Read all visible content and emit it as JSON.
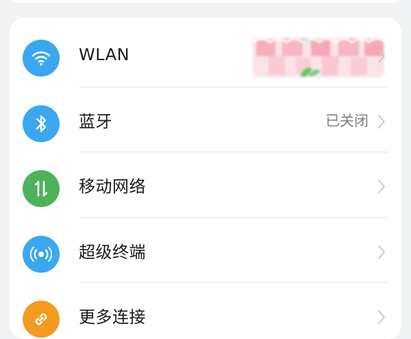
{
  "colors": {
    "blue_icon": "#3aa7f0",
    "green_icon": "#4cb35a",
    "orange_icon": "#f39a1f",
    "divider": "#e6e6e6",
    "value_text": "#808080"
  },
  "settings": {
    "items": [
      {
        "label": "WLAN",
        "value": "",
        "icon": "wifi-icon"
      },
      {
        "label": "蓝牙",
        "value": "已关闭",
        "icon": "bluetooth-icon"
      },
      {
        "label": "移动网络",
        "value": "",
        "icon": "mobile-data-icon"
      },
      {
        "label": "超级终端",
        "value": "",
        "icon": "super-device-icon"
      },
      {
        "label": "更多连接",
        "value": "",
        "icon": "link-icon"
      }
    ]
  }
}
